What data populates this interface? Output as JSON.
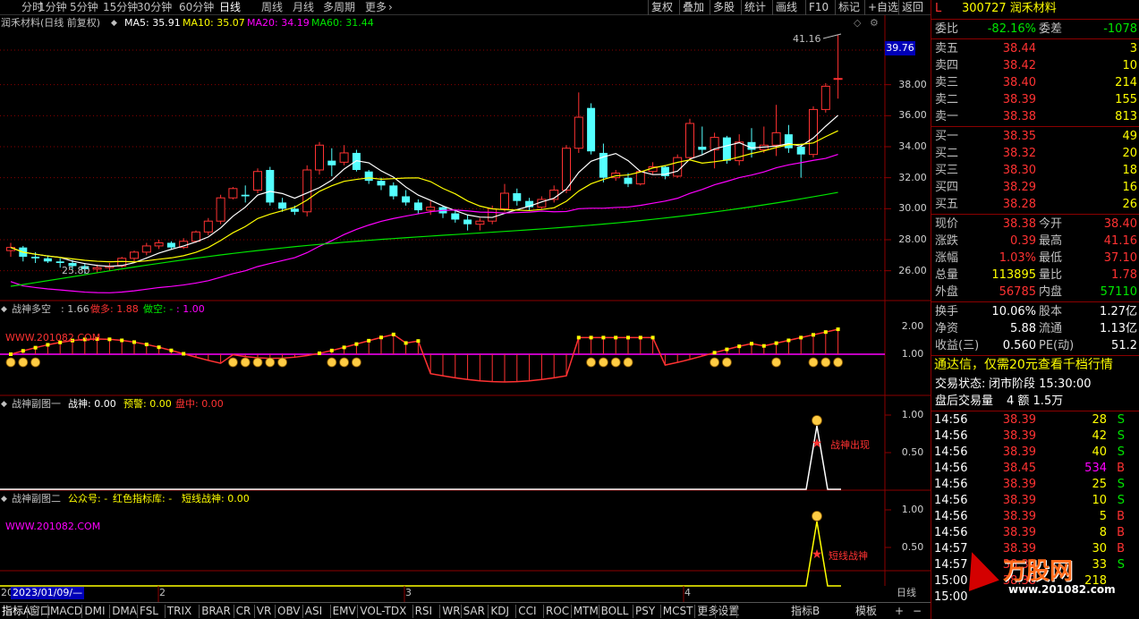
{
  "toolbar": {
    "periods": [
      "分时",
      "1分钟",
      "5分钟",
      "15分钟",
      "30分钟",
      "60分钟",
      "日线",
      "周线",
      "月线",
      "多周期",
      "更多"
    ],
    "active": "日线",
    "right": [
      "复权",
      "叠加",
      "多股",
      "统计",
      "画线",
      "F10",
      "标记",
      "+自选",
      "返回"
    ]
  },
  "main_legend": {
    "name": "润禾材料(日线 前复权)",
    "ma5": "MA5: 35.91",
    "ma10": "MA10: 35.07",
    "ma20": "MA20: 34.19",
    "ma60": "MA60: 31.44"
  },
  "colors": {
    "up": "#ff3232",
    "down": "#54ffff",
    "ma5": "#ffffff",
    "ma10": "#ffff00",
    "ma20": "#ff00ff",
    "ma60": "#00e600",
    "border": "#8b0000"
  },
  "price_axis": [
    "38.00",
    "36.00",
    "34.00",
    "32.00",
    "30.00",
    "28.00",
    "26.00"
  ],
  "price_tag": "39.76",
  "high_label": "41.16",
  "low_label": "25.80",
  "chart_data": {
    "type": "candlestick",
    "ylim": [
      25.0,
      41.5
    ],
    "candles": [
      [
        27.3,
        27.8,
        26.9,
        27.5
      ],
      [
        27.5,
        27.6,
        26.6,
        26.9
      ],
      [
        26.9,
        27.2,
        26.5,
        26.8
      ],
      [
        26.8,
        27.0,
        26.5,
        26.6
      ],
      [
        26.6,
        26.8,
        26.2,
        26.5
      ],
      [
        26.5,
        26.7,
        26.1,
        26.3
      ],
      [
        26.3,
        26.5,
        25.8,
        26.1
      ],
      [
        26.1,
        26.4,
        25.9,
        26.2
      ],
      [
        26.2,
        26.5,
        26.0,
        26.3
      ],
      [
        26.3,
        26.9,
        26.2,
        26.8
      ],
      [
        26.8,
        27.3,
        26.6,
        27.2
      ],
      [
        27.2,
        27.8,
        27.0,
        27.6
      ],
      [
        27.6,
        28.0,
        27.4,
        27.8
      ],
      [
        27.8,
        27.9,
        27.4,
        27.5
      ],
      [
        27.5,
        28.1,
        27.4,
        27.9
      ],
      [
        27.9,
        28.6,
        27.8,
        28.5
      ],
      [
        28.5,
        29.4,
        28.3,
        29.2
      ],
      [
        29.2,
        30.9,
        29.0,
        30.7
      ],
      [
        30.7,
        31.4,
        30.6,
        31.3
      ],
      [
        30.9,
        31.5,
        30.4,
        30.8
      ],
      [
        31.2,
        32.6,
        31.0,
        32.4
      ],
      [
        32.5,
        32.7,
        30.2,
        30.4
      ],
      [
        30.4,
        30.7,
        29.8,
        30.0
      ],
      [
        30.0,
        30.2,
        29.6,
        29.8
      ],
      [
        29.8,
        32.8,
        29.5,
        32.5
      ],
      [
        32.5,
        34.3,
        32.2,
        34.1
      ],
      [
        33.1,
        33.9,
        32.1,
        32.8
      ],
      [
        33.0,
        34.1,
        32.8,
        33.6
      ],
      [
        33.6,
        33.8,
        32.4,
        32.5
      ],
      [
        32.4,
        32.5,
        31.6,
        31.8
      ],
      [
        31.8,
        32.0,
        31.2,
        31.5
      ],
      [
        31.5,
        31.7,
        30.6,
        30.8
      ],
      [
        30.8,
        31.2,
        30.2,
        30.4
      ],
      [
        30.4,
        30.6,
        29.7,
        29.9
      ],
      [
        29.9,
        30.5,
        29.6,
        30.1
      ],
      [
        30.1,
        30.2,
        29.4,
        29.7
      ],
      [
        29.7,
        29.9,
        29.1,
        29.3
      ],
      [
        29.3,
        29.6,
        28.6,
        29.0
      ],
      [
        29.0,
        29.4,
        28.6,
        29.2
      ],
      [
        29.2,
        30.2,
        29.0,
        30.0
      ],
      [
        30.0,
        31.6,
        29.8,
        31.0
      ],
      [
        31.0,
        31.3,
        30.2,
        30.5
      ],
      [
        30.5,
        30.7,
        29.9,
        30.1
      ],
      [
        30.1,
        30.8,
        30.0,
        30.6
      ],
      [
        30.6,
        31.5,
        30.4,
        31.2
      ],
      [
        31.2,
        34.1,
        31.0,
        33.9
      ],
      [
        33.9,
        37.5,
        33.6,
        35.9
      ],
      [
        36.5,
        36.8,
        33.5,
        33.7
      ],
      [
        33.6,
        34.2,
        31.7,
        32.0
      ],
      [
        32.0,
        32.5,
        31.8,
        32.3
      ],
      [
        32.0,
        32.3,
        31.4,
        31.6
      ],
      [
        31.6,
        32.5,
        31.5,
        32.4
      ],
      [
        32.4,
        33.0,
        32.2,
        32.7
      ],
      [
        32.7,
        32.8,
        31.9,
        32.1
      ],
      [
        32.1,
        33.5,
        32.0,
        33.3
      ],
      [
        33.3,
        35.8,
        33.1,
        35.5
      ],
      [
        34.0,
        35.3,
        33.5,
        33.8
      ],
      [
        33.8,
        34.9,
        32.6,
        34.6
      ],
      [
        34.6,
        34.7,
        32.9,
        33.1
      ],
      [
        33.1,
        34.8,
        32.8,
        34.3
      ],
      [
        34.3,
        35.2,
        33.3,
        33.8
      ],
      [
        33.8,
        35.3,
        33.6,
        34.1
      ],
      [
        34.1,
        36.7,
        33.4,
        34.9
      ],
      [
        34.8,
        35.4,
        33.6,
        33.9
      ],
      [
        34.0,
        34.2,
        32.0,
        33.5
      ],
      [
        33.5,
        36.6,
        33.3,
        36.4
      ],
      [
        36.4,
        38.1,
        36.2,
        37.9
      ],
      [
        38.4,
        41.2,
        37.1,
        38.4
      ]
    ],
    "ma60_endpoints": [
      25.0,
      31.44
    ]
  },
  "panel1": {
    "legend_name": "战神多空",
    "legend_val": ": 1.66",
    "legend_buy": "做多: 1.88",
    "legend_sell": "做空: -",
    "legend_sell2": ": 1.00",
    "watermark": "WWW.201082.COM",
    "axis": [
      "2.00",
      "1.00"
    ]
  },
  "panel2": {
    "legend_name": "战神副图一",
    "legend_a": "战神: 0.00",
    "legend_b": "预警: 0.00",
    "legend_c": "盘中: 0.00",
    "axis": [
      "1.00",
      "0.50"
    ],
    "signal": "战神出现"
  },
  "panel3": {
    "legend_name": "战神副图二",
    "legend_a": "公众号: -",
    "legend_b": "红色指标库: -",
    "legend_c": "短线战神: 0.00",
    "watermark": "WWW.201082.COM",
    "axis": [
      "1.00",
      "0.50"
    ],
    "signal": "短线战神"
  },
  "xaxis": {
    "date_tag": "2023/01/09/—",
    "months": [
      "2",
      "3",
      "4"
    ],
    "period_label": "日线",
    "start": "20"
  },
  "bottom": [
    "指标A",
    "窗口",
    "MACD",
    "DMI",
    "DMA",
    "FSL",
    "TRIX",
    "BRAR",
    "CR",
    "VR",
    "OBV",
    "ASI",
    "EMV",
    "VOL-TDX",
    "RSI",
    "WR",
    "SAR",
    "KDJ",
    "CCI",
    "ROC",
    "MTM",
    "BOLL",
    "PSY",
    "MCST",
    "更多",
    "设置"
  ],
  "bottom_right": [
    "指标B",
    "模板",
    "+",
    "−"
  ],
  "quote": {
    "code_prefix": "L",
    "code": "300727 润禾材料",
    "weibi_label": "委比",
    "weibi": "-82.16%",
    "weicha_label": "委差",
    "weicha": "-1078",
    "asks": [
      {
        "label": "卖五",
        "price": "38.44",
        "vol": "3"
      },
      {
        "label": "卖四",
        "price": "38.42",
        "vol": "10"
      },
      {
        "label": "卖三",
        "price": "38.40",
        "vol": "214"
      },
      {
        "label": "卖二",
        "price": "38.39",
        "vol": "155"
      },
      {
        "label": "卖一",
        "price": "38.38",
        "vol": "813"
      }
    ],
    "bids": [
      {
        "label": "买一",
        "price": "38.35",
        "vol": "49"
      },
      {
        "label": "买二",
        "price": "38.32",
        "vol": "20"
      },
      {
        "label": "买三",
        "price": "38.30",
        "vol": "18"
      },
      {
        "label": "买四",
        "price": "38.29",
        "vol": "16"
      },
      {
        "label": "买五",
        "price": "38.28",
        "vol": "26"
      }
    ],
    "stats": [
      {
        "l1": "现价",
        "v1": "38.38",
        "l2": "今开",
        "v2": "38.40",
        "c1": "#ff3232",
        "c2": "#ff3232"
      },
      {
        "l1": "涨跌",
        "v1": "0.39",
        "l2": "最高",
        "v2": "41.16",
        "c1": "#ff3232",
        "c2": "#ff3232"
      },
      {
        "l1": "涨幅",
        "v1": "1.03%",
        "l2": "最低",
        "v2": "37.10",
        "c1": "#ff3232",
        "c2": "#ff3232"
      },
      {
        "l1": "总量",
        "v1": "113895",
        "l2": "量比",
        "v2": "1.78",
        "c1": "#ffff00",
        "c2": "#ff3232"
      },
      {
        "l1": "外盘",
        "v1": "56785",
        "l2": "内盘",
        "v2": "57110",
        "c1": "#ff3232",
        "c2": "#00e600"
      }
    ],
    "stats2": [
      {
        "l1": "换手",
        "v1": "10.06%",
        "l2": "股本",
        "v2": "1.27亿"
      },
      {
        "l1": "净资",
        "v1": "5.88",
        "l2": "流通",
        "v2": "1.13亿"
      },
      {
        "l1": "收益(三)",
        "v1": "0.560",
        "l2": "PE(动)",
        "v2": "51.2"
      }
    ],
    "promo": "通达信，仅需20元查看千档行情",
    "trade_status_label": "交易状态:",
    "trade_status": "闭市阶段 15:30:00",
    "after_label": "盘后交易量",
    "after_value": "4 额 1.5万",
    "ticks": [
      {
        "t": "14:56",
        "p": "38.39",
        "v": "28",
        "s": "S"
      },
      {
        "t": "14:56",
        "p": "38.39",
        "v": "42",
        "s": "S"
      },
      {
        "t": "14:56",
        "p": "38.39",
        "v": "40",
        "s": "S"
      },
      {
        "t": "14:56",
        "p": "38.45",
        "v": "534",
        "s": "B"
      },
      {
        "t": "14:56",
        "p": "38.39",
        "v": "25",
        "s": "S"
      },
      {
        "t": "14:56",
        "p": "38.39",
        "v": "10",
        "s": "S"
      },
      {
        "t": "14:56",
        "p": "38.39",
        "v": "5",
        "s": "B"
      },
      {
        "t": "14:56",
        "p": "38.39",
        "v": "8",
        "s": "B"
      },
      {
        "t": "14:57",
        "p": "38.39",
        "v": "30",
        "s": "B"
      },
      {
        "t": "14:57",
        "p": "38.39",
        "v": "33",
        "s": "S"
      },
      {
        "t": "15:00",
        "p": "38.38",
        "v": "218",
        "s": ""
      },
      {
        "t": "15:00",
        "p": "",
        "v": "",
        "s": ""
      }
    ],
    "logo": "万股网",
    "logo_url": "www.201082.com"
  }
}
